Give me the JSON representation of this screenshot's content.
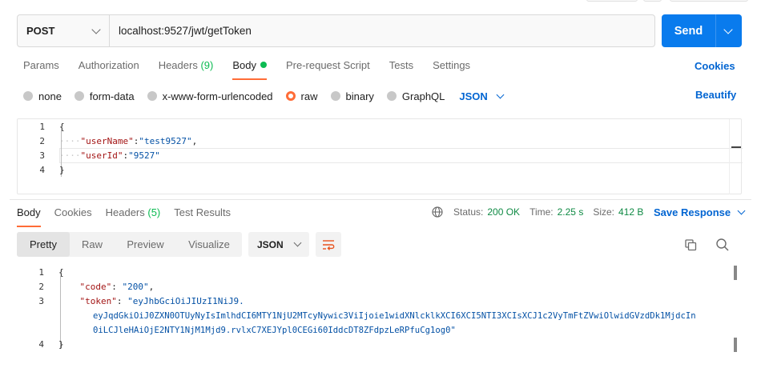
{
  "request": {
    "method": "POST",
    "url": "localhost:9527/jwt/getToken",
    "send_label": "Send"
  },
  "request_tabs": [
    {
      "label": "Params",
      "count": ""
    },
    {
      "label": "Authorization",
      "count": ""
    },
    {
      "label": "Headers ",
      "count": "(9)"
    },
    {
      "label": "Body",
      "count": ""
    },
    {
      "label": "Pre-request Script",
      "count": ""
    },
    {
      "label": "Tests",
      "count": ""
    },
    {
      "label": "Settings",
      "count": ""
    }
  ],
  "cookies_label": "Cookies",
  "body_types": [
    "none",
    "form-data",
    "x-www-form-urlencoded",
    "raw",
    "binary",
    "GraphQL"
  ],
  "body_language": "JSON",
  "beautify_label": "Beautify",
  "request_body": {
    "line_numbers": [
      "1",
      "2",
      "3",
      "4"
    ],
    "open": "{",
    "close": "}",
    "k1": "\"userName\"",
    "v1": "\"test9527\"",
    "k2": "\"userId\"",
    "v2": "\"9527\""
  },
  "response_tabs": [
    {
      "label": "Body",
      "count": ""
    },
    {
      "label": "Cookies",
      "count": ""
    },
    {
      "label": "Headers ",
      "count": "(5)"
    },
    {
      "label": "Test Results",
      "count": ""
    }
  ],
  "status": {
    "status_label": "Status:",
    "status_value": "200 OK",
    "time_label": "Time:",
    "time_value": "2.25 s",
    "size_label": "Size:",
    "size_value": "412 B"
  },
  "save_response_label": "Save Response",
  "view_modes": [
    "Pretty",
    "Raw",
    "Preview",
    "Visualize"
  ],
  "response_format": "JSON",
  "response_body": {
    "line_numbers": [
      "1",
      "2",
      "3",
      "4"
    ],
    "open": "{",
    "close": "}",
    "k1": "\"code\"",
    "v1": "\"200\"",
    "k2": "\"token\"",
    "token_1": "\"eyJhbGciOiJIUzI1NiJ9.",
    "token_2": "eyJqdGkiOiJ0ZXN0OTUyNyIsImlhdCI6MTY1NjU2MTcyNywic3ViIjoie1widXNlcklkXCI6XCI5NTI3XCIsXCJ1c2VyTmFtZVwiOlwidGVzdDk1MjdcIn",
    "token_3": "0iLCJleHAiOjE2NTY1NjM1Mjd9.rvlxC7XEJYpl0CEGi60IddcDT8ZFdpzLeRPfuCg1og0\""
  },
  "colors": {
    "accent": "#ff6c37",
    "primary": "#097bed",
    "link": "#0265d2",
    "success": "#0cbb52"
  }
}
